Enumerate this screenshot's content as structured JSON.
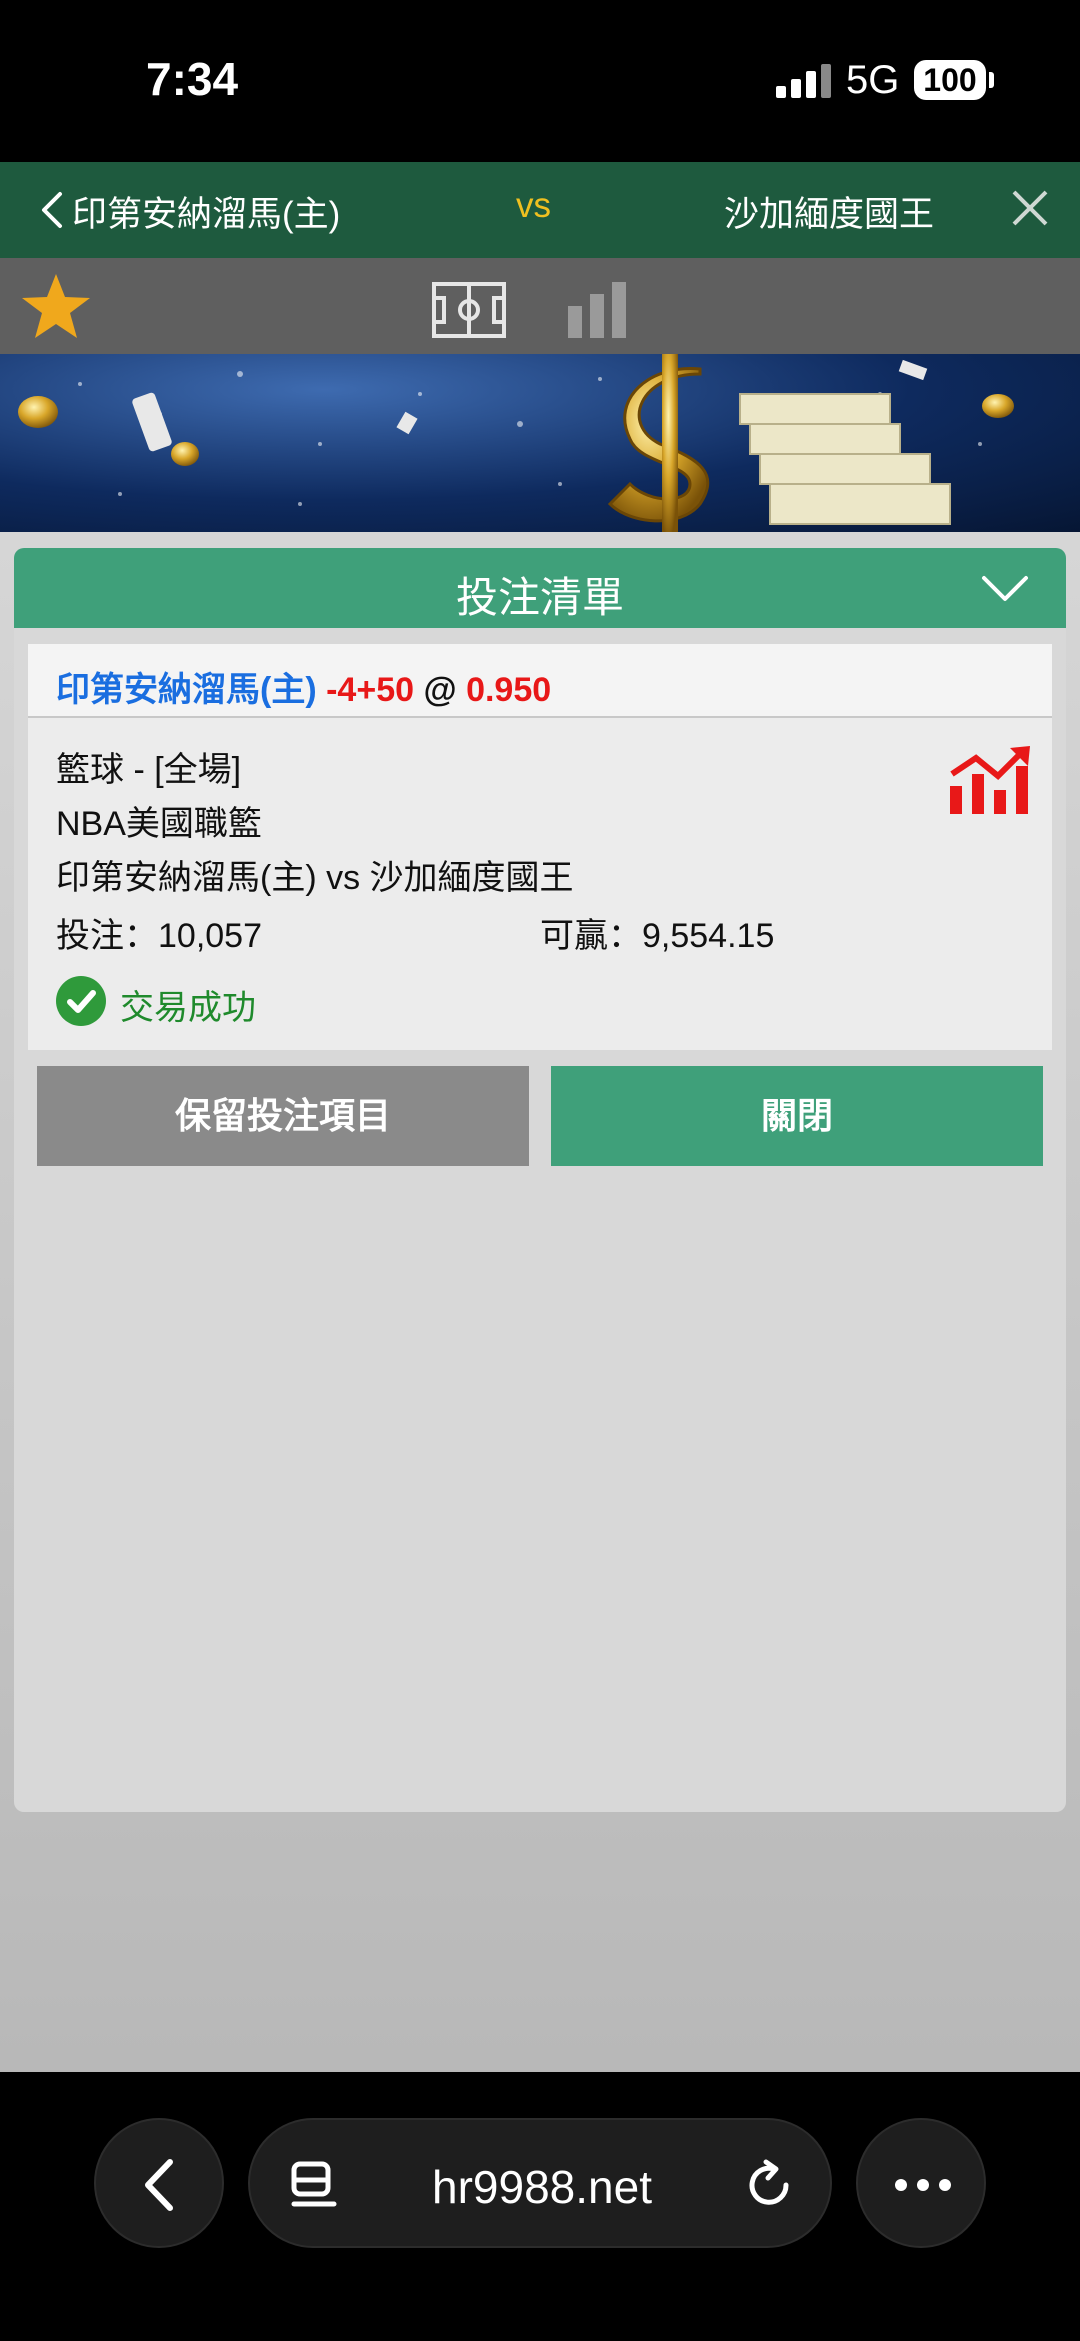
{
  "status_bar": {
    "time": "7:34",
    "network": "5G",
    "battery": "100"
  },
  "match_header": {
    "home_team": "印第安納溜馬(主)",
    "vs": "vs",
    "away_team": "沙加緬度國王"
  },
  "bet_slip": {
    "title": "投注清單",
    "selection": {
      "team": "印第安納溜馬(主)",
      "handicap": "-4+50",
      "at": "@",
      "odds": "0.950"
    },
    "sport_market": "籃球 - [全場]",
    "league": "NBA美國職籃",
    "match": "印第安納溜馬(主) vs 沙加緬度國王",
    "stake_label": "投注：10,057",
    "win_label": "可贏：9,554.15",
    "status": "交易成功",
    "keep_button": "保留投注項目",
    "close_button": "關閉"
  },
  "browser": {
    "url": "hr9988.net"
  },
  "colors": {
    "header_green": "#1e5a3e",
    "accent_green": "#3fa07a",
    "odds_red": "#e81818",
    "team_blue": "#1a6ee0"
  }
}
